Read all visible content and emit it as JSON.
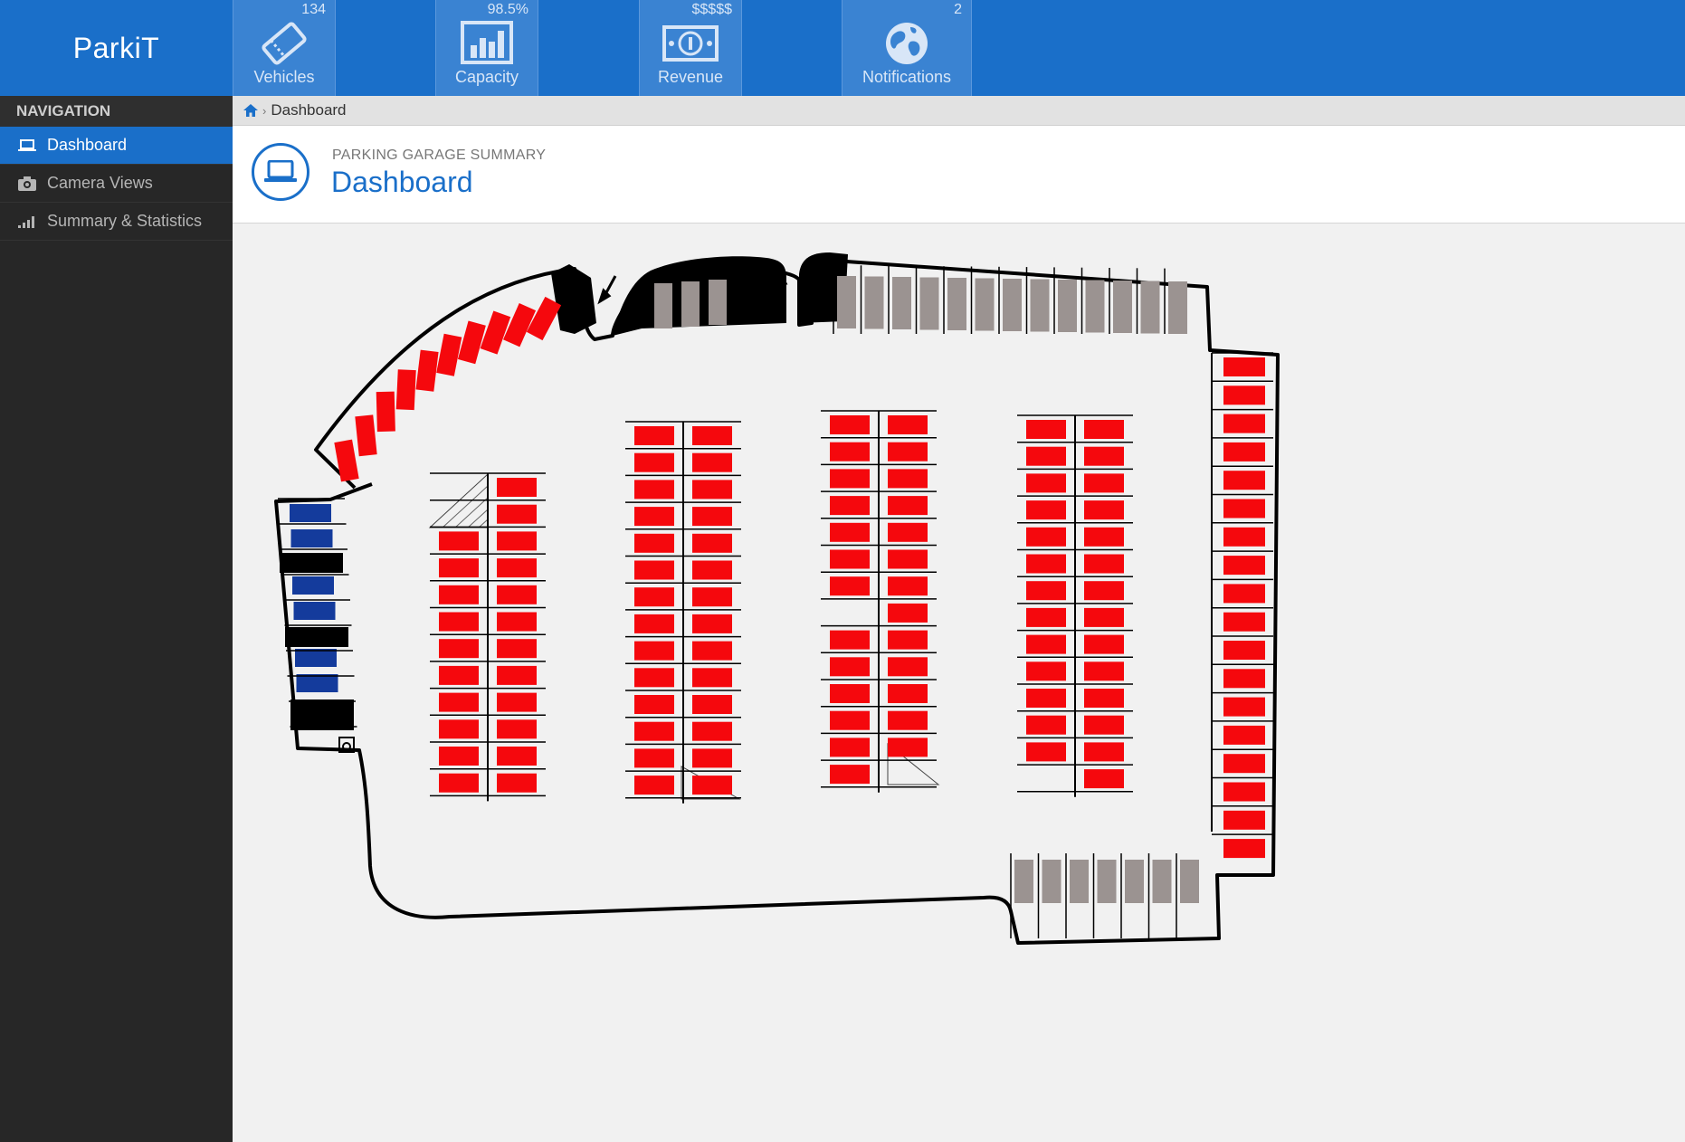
{
  "app": {
    "brand": "ParkiT"
  },
  "topbar": {
    "stats": [
      {
        "value": "134",
        "label": "Vehicles",
        "icon": "ticket-icon"
      },
      {
        "value": "98.5%",
        "label": "Capacity",
        "icon": "bar-chart-icon"
      },
      {
        "value": "$$$$$",
        "label": "Revenue",
        "icon": "money-icon"
      },
      {
        "value": "2",
        "label": "Notifications",
        "icon": "globe-icon"
      }
    ]
  },
  "sidebar": {
    "heading": "NAVIGATION",
    "items": [
      {
        "label": "Dashboard",
        "icon": "laptop-icon",
        "active": true
      },
      {
        "label": "Camera Views",
        "icon": "camera-icon",
        "active": false
      },
      {
        "label": "Summary & Statistics",
        "icon": "signal-icon",
        "active": false
      }
    ]
  },
  "breadcrumb": {
    "home_icon": "home-icon",
    "current": "Dashboard"
  },
  "page": {
    "subtitle": "PARKING GARAGE SUMMARY",
    "title": "Dashboard",
    "icon": "laptop-icon"
  },
  "map": {
    "legend_colors": {
      "occupied": "#f5080d",
      "available": "#9b9391",
      "accessible": "#143b9c"
    }
  }
}
